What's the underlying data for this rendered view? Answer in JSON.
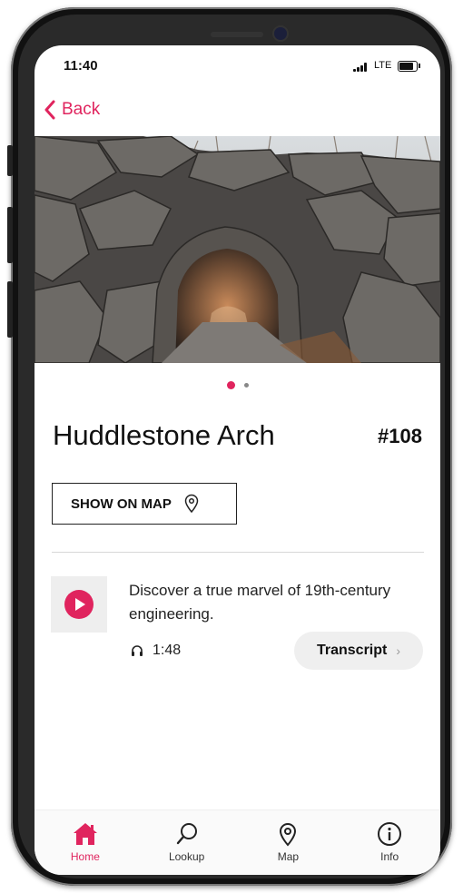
{
  "status_bar": {
    "time": "11:40",
    "network": "LTE"
  },
  "nav": {
    "back_label": "Back"
  },
  "hero": {
    "image_description": "Stone arch tunnel",
    "page_count": 2,
    "active_page": 1
  },
  "stop": {
    "title": "Huddlestone Arch",
    "number": "#108"
  },
  "actions": {
    "show_on_map_label": "SHOW ON MAP"
  },
  "audio": {
    "description": "Discover a true marvel of 19th-century engineering.",
    "duration": "1:48",
    "transcript_label": "Transcript"
  },
  "tabs": [
    {
      "label": "Home",
      "icon": "home-icon",
      "active": true
    },
    {
      "label": "Lookup",
      "icon": "search-icon",
      "active": false
    },
    {
      "label": "Map",
      "icon": "map-pin-icon",
      "active": false
    },
    {
      "label": "Info",
      "icon": "info-icon",
      "active": false
    }
  ],
  "colors": {
    "accent": "#e0245e",
    "text": "#111111",
    "muted_bg": "#eeeeee"
  }
}
